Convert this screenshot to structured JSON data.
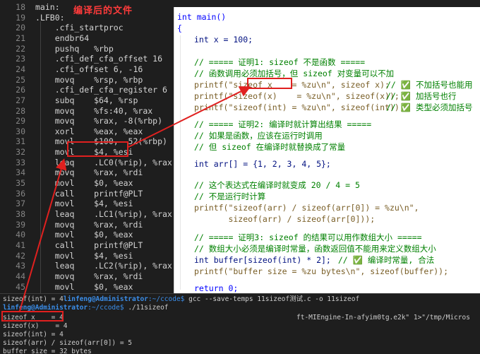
{
  "annotation": {
    "note": "编译后的文件"
  },
  "assembly": {
    "line_numbers": [
      "18",
      "19",
      "20",
      "21",
      "22",
      "23",
      "24",
      "25",
      "26",
      "27",
      "28",
      "29",
      "30",
      "31",
      "32",
      "33",
      "34",
      "35",
      "36",
      "37",
      "38",
      "39",
      "40",
      "41",
      "42",
      "43",
      "44",
      "45"
    ],
    "lines": [
      "main:",
      ".LFB0:",
      "    .cfi_startproc",
      "    endbr64",
      "    pushq   %rbp",
      "    .cfi_def_cfa_offset 16",
      "    .cfi_offset 6, -16",
      "    movq    %rsp, %rbp",
      "    .cfi_def_cfa_register 6",
      "    subq    $64, %rsp",
      "    movq    %fs:40, %rax",
      "    movq    %rax, -8(%rbp)",
      "    xorl    %eax, %eax",
      "    movl    $100, -52(%rbp)",
      "    movl    $4, %esi",
      "    leaq    .LC0(%rip), %rax",
      "    movq    %rax, %rdi",
      "    movl    $0, %eax",
      "    call    printf@PLT",
      "    movl    $4, %esi",
      "    leaq    .LC1(%rip), %rax",
      "    movq    %rax, %rdi",
      "    movl    $0, %eax",
      "    call    printf@PLT",
      "    movl    $4, %esi",
      "    leaq    .LC2(%rip), %rax",
      "    movq    %rax, %rdi",
      "    movl    $0, %eax"
    ]
  },
  "source": {
    "main_sig": "int main()",
    "open_brace": "{",
    "x_decl": "int x = 100;",
    "c1_title": "// ===== 证明1: sizeof 不是函数 =====",
    "c1_desc": "// 函数调用必须加括号，但 sizeof 对变量可以不加",
    "p1_code": "printf(\"sizeof x    = %zu\\n\", sizeof x);",
    "p1_cm": "// ✅ 不加括号也能用",
    "p2_code": "printf(\"sizeof(x)    = %zu\\n\", sizeof(x));",
    "p2_cm": "// ✅ 加括号也行",
    "p3_code": "printf(\"sizeof(int) = %zu\\n\", sizeof(int));",
    "p3_cm": "// ✅ 类型必须加括号",
    "c2_title": "// ===== 证明2: 编译时就计算出结果 =====",
    "c2_desc1": "// 如果是函数，应该在运行时调用",
    "c2_desc2": "// 但 sizeof 在编译时就替换成了常量",
    "arr_decl": "int arr[] = {1, 2, 3, 4, 5};",
    "c2_note1": "// 这个表达式在编译时就变成 20 / 4 = 5",
    "c2_note2": "// 不是运行时计算",
    "p4_line1": "printf(\"sizeof(arr) / sizeof(arr[0]) = %zu\\n\",",
    "p4_line2": "       sizeof(arr) / sizeof(arr[0]));",
    "c3_title": "// ===== 证明3: sizeof 的结果可以用作数组大小 =====",
    "c3_desc": "// 数组大小必须是编译时常量，函数返回值不能用来定义数组大小",
    "buf_code": "int buffer[sizeof(int) * 2];",
    "buf_cm": "// ✅ 编译时常量, 合法",
    "p5_code": "printf(\"buffer size = %zu bytes\\n\", sizeof(buffer));",
    "ret": "return 0;"
  },
  "terminal": {
    "partial_line": "sizeof(int) = 4",
    "prompt_user": "linfeng@Administrator",
    "prompt_path": ":~/ccode$",
    "cmd1": " gcc --save-temps 11sizeof测试.c -o 11sizeof",
    "cmd2": " ./11sizeof",
    "out1": "sizeof x    = 4",
    "out2": "sizeof(x)    = 4",
    "out3": "sizeof(int) = 4",
    "out4": "sizeof(arr) / sizeof(arr[0]) = 5",
    "out5": "buffer size = 32 bytes",
    "side_text": "ft-MIEngine-In-afyim0tg.e2k\" 1>\"/tmp/Micros"
  }
}
